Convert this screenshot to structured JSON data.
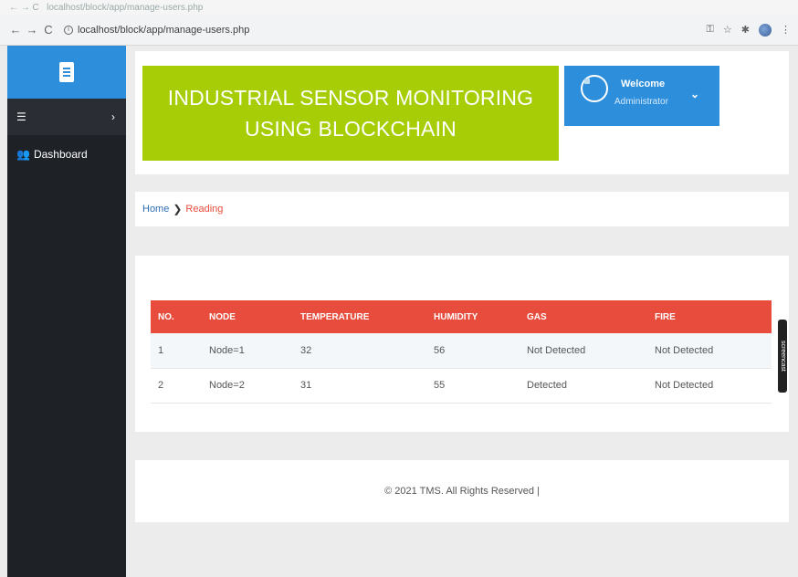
{
  "browser": {
    "ghost_url": "localhost/block/app/manage-users.php",
    "url": "localhost/block/app/manage-users.php"
  },
  "sidebar": {
    "items": [
      {
        "label": "Dashboard",
        "icon": "users-icon"
      }
    ]
  },
  "header": {
    "title": "INDUSTRIAL SENSOR MONITORING USING BLOCKCHAIN",
    "welcome_title": "Welcome",
    "welcome_subtitle": "Administrator"
  },
  "breadcrumb": {
    "home": "Home",
    "current": "Reading"
  },
  "table": {
    "columns": [
      "NO.",
      "NODE",
      "TEMPERATURE",
      "HUMIDITY",
      "GAS",
      "FIRE"
    ],
    "rows": [
      [
        "1",
        "Node=1",
        "32",
        "56",
        "Not Detected",
        "Not Detected"
      ],
      [
        "2",
        "Node=2",
        "31",
        "55",
        "Detected",
        "Not Detected"
      ]
    ]
  },
  "footer": {
    "text": "© 2021 TMS. All Rights Reserved |"
  },
  "side_tab": {
    "label": "screencast"
  },
  "colors": {
    "accent_blue": "#2d8fdc",
    "title_green": "#a6cd05",
    "table_header_red": "#e74c3c",
    "sidebar_dark": "#1e2126"
  }
}
